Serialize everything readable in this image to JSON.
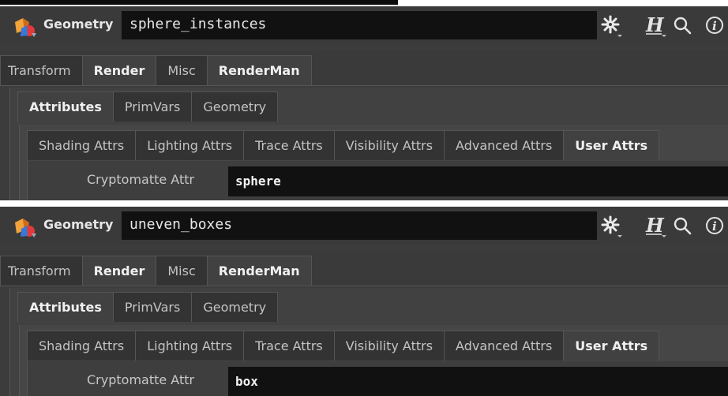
{
  "panels": [
    {
      "node_type": "Geometry",
      "node_name": "sphere_instances",
      "tabs_level1": [
        "Transform",
        "Render",
        "Misc",
        "RenderMan"
      ],
      "tabs_level2": [
        "Attributes",
        "PrimVars",
        "Geometry"
      ],
      "tabs_level3": [
        "Shading Attrs",
        "Lighting Attrs",
        "Trace Attrs",
        "Visibility Attrs",
        "Advanced Attrs",
        "User Attrs"
      ],
      "param_label": "Cryptomatte Attr",
      "param_value": "sphere"
    },
    {
      "node_type": "Geometry",
      "node_name": "uneven_boxes",
      "tabs_level1": [
        "Transform",
        "Render",
        "Misc",
        "RenderMan"
      ],
      "tabs_level2": [
        "Attributes",
        "PrimVars",
        "Geometry"
      ],
      "tabs_level3": [
        "Shading Attrs",
        "Lighting Attrs",
        "Trace Attrs",
        "Visibility Attrs",
        "Advanced Attrs",
        "User Attrs"
      ],
      "param_label": "Cryptomatte Attr",
      "param_value": "box"
    }
  ],
  "icons": [
    "geometry-node-icon",
    "gear-icon",
    "houdini-help-icon",
    "search-icon",
    "info-icon"
  ],
  "colors": {
    "panel_bg": "#3c3c3c",
    "field_bg": "#111111",
    "text": "#d8d8d8"
  }
}
